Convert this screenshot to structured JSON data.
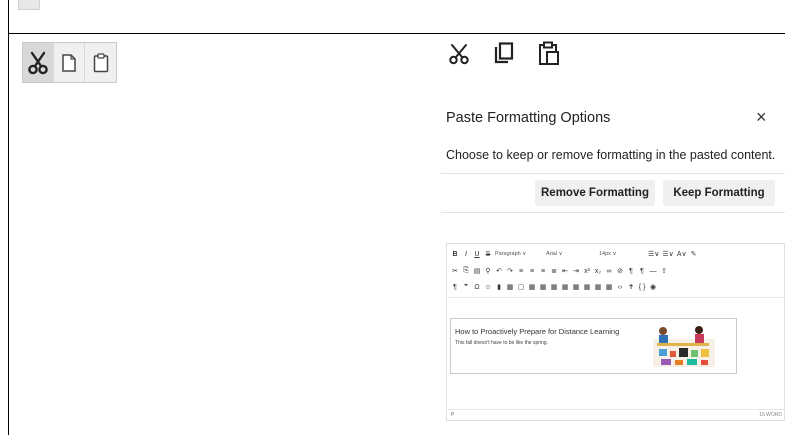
{
  "old_toolbar": {
    "buttons": [
      "cut-icon",
      "copy-icon",
      "paste-icon"
    ],
    "active": "cut-icon"
  },
  "new_toolbar": {
    "buttons": [
      "cut-icon",
      "copy-icon",
      "paste-icon"
    ]
  },
  "dialog": {
    "title": "Paste Formatting Options",
    "close_label": "×",
    "description": "Choose to keep or remove formatting in the pasted content.",
    "remove_label": "Remove Formatting",
    "keep_label": "Keep Formatting"
  },
  "mini_editor": {
    "row1": [
      "B",
      "I",
      "U",
      "S",
      "Paragraph ∨",
      "Arial ∨",
      "14px ∨",
      "☰∨",
      "☰∨",
      "A∨",
      "✎"
    ],
    "card_title": "How to Proactively Prepare for Distance Learning",
    "card_subtitle": "This fall doesn't have to be like the spring.",
    "status_left": "P",
    "status_right": "16 WORD"
  },
  "colors": {
    "border": "#000000",
    "button_bg": "#f0f0f0",
    "active_bg": "#d8d8d8"
  }
}
